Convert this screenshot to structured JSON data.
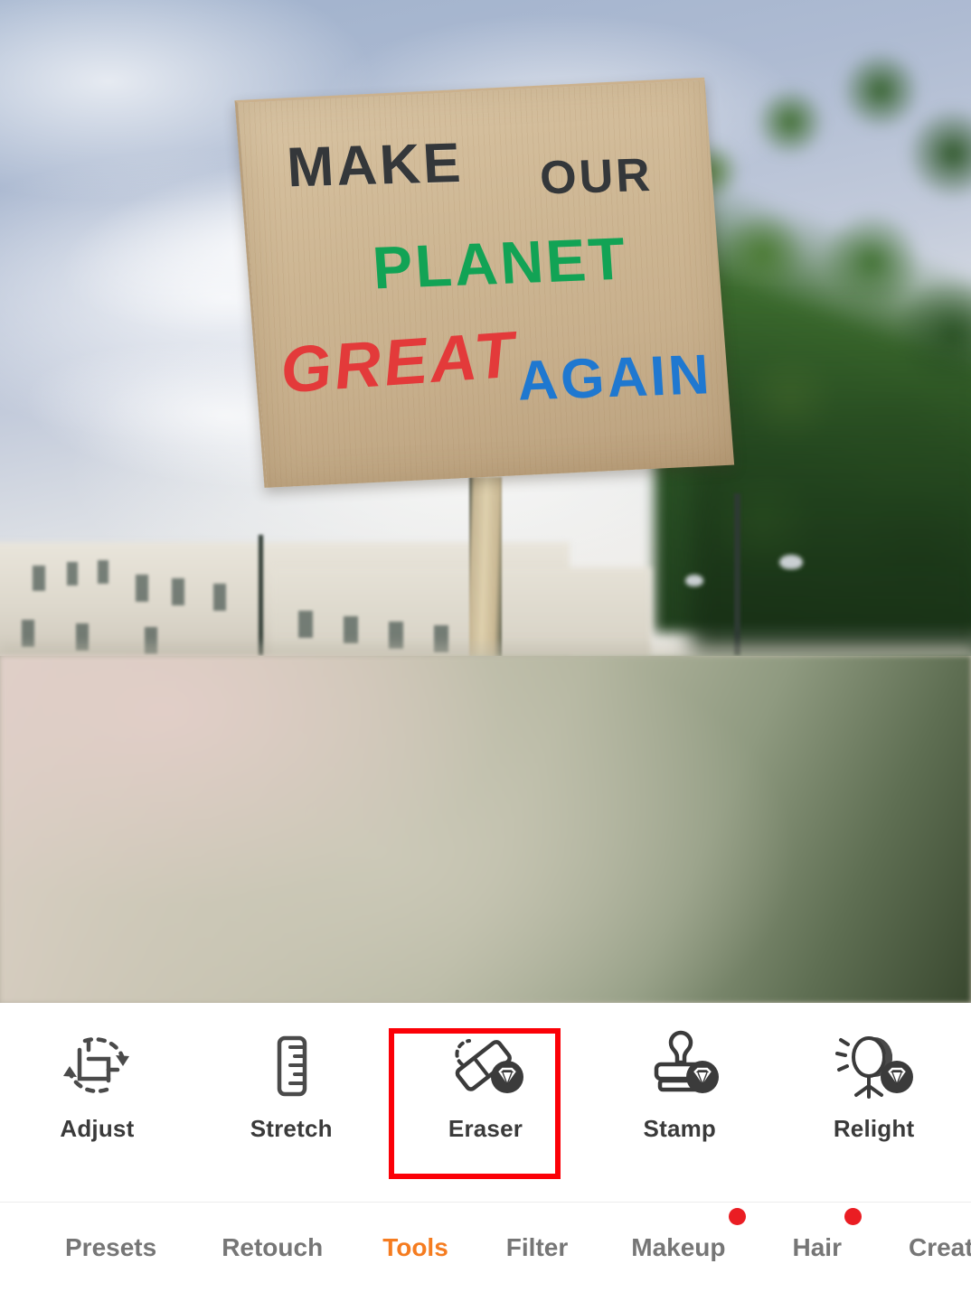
{
  "app": {
    "type": "photo-editor",
    "accent_color": "#f57c20",
    "highlight_color": "#fb0007",
    "badge_color": "#ea1d23"
  },
  "photo": {
    "description": "Protest sign photo",
    "sign_lines": [
      {
        "text": "MAKE",
        "color": "#34373a"
      },
      {
        "text": "OUR",
        "color": "#34373a"
      },
      {
        "text": "PLANET",
        "color": "#12a355"
      },
      {
        "text": "GREAT",
        "color": "#e33a3a"
      },
      {
        "text": "AGAIN",
        "color": "#1f78d0"
      }
    ]
  },
  "tools": {
    "items": [
      {
        "label": "Adjust",
        "icon": "crop-rotate-icon",
        "premium": false,
        "selected": false
      },
      {
        "label": "Stretch",
        "icon": "ruler-icon",
        "premium": false,
        "selected": false
      },
      {
        "label": "Eraser",
        "icon": "eraser-icon",
        "premium": true,
        "selected": true
      },
      {
        "label": "Stamp",
        "icon": "stamp-icon",
        "premium": true,
        "selected": false
      },
      {
        "label": "Relight",
        "icon": "studio-light-icon",
        "premium": true,
        "selected": false
      }
    ]
  },
  "tabs": {
    "active": "Tools",
    "items": [
      {
        "label": "Presets",
        "active": false,
        "badge": false
      },
      {
        "label": "Retouch",
        "active": false,
        "badge": false
      },
      {
        "label": "Tools",
        "active": true,
        "badge": false
      },
      {
        "label": "Filter",
        "active": false,
        "badge": false
      },
      {
        "label": "Makeup",
        "active": false,
        "badge": true
      },
      {
        "label": "Hair",
        "active": false,
        "badge": true
      },
      {
        "label": "Creativ",
        "active": false,
        "badge": false
      }
    ]
  }
}
